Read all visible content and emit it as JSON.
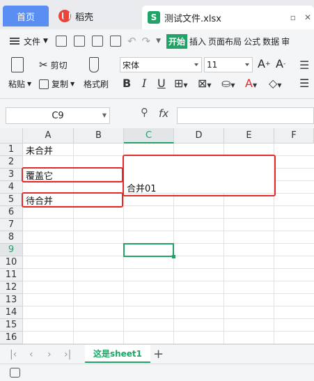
{
  "tabs": {
    "home": "首页",
    "daoke": "稻壳",
    "file": "测试文件.xlsx"
  },
  "menu": {
    "file": "文件",
    "items": [
      "开始",
      "插入",
      "页面布局",
      "公式",
      "数据",
      "审"
    ]
  },
  "ribbon": {
    "paste": "粘贴",
    "cut": "剪切",
    "copy": "复制",
    "format_painter": "格式刷",
    "font_name": "宋体",
    "font_size": "11"
  },
  "formula_bar": {
    "cell_ref": "C9",
    "fx": "fx",
    "value": ""
  },
  "columns": [
    "A",
    "B",
    "C",
    "D",
    "E",
    "F"
  ],
  "active_column": "C",
  "rows": [
    "1",
    "2",
    "3",
    "4",
    "5",
    "6",
    "7",
    "8",
    "9",
    "10",
    "11",
    "12",
    "13",
    "14",
    "15",
    "16"
  ],
  "active_row": "9",
  "cells": {
    "A1": "未合并",
    "A3": "覆盖它",
    "A5": "待合并",
    "C4": "合并01"
  },
  "sheet": {
    "name": "这是sheet1"
  },
  "colors": {
    "accent": "#1fa366",
    "highlight": "#e32a2a",
    "home_tab": "#5a8ef2"
  }
}
